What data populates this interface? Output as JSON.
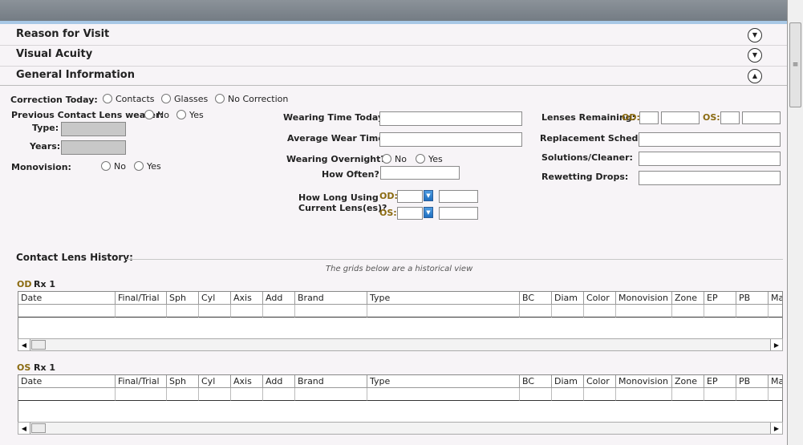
{
  "accordion": {
    "sections": [
      {
        "title": "Reason for Visit",
        "state": "collapsed"
      },
      {
        "title": "Visual Acuity",
        "state": "collapsed"
      },
      {
        "title": "General Information",
        "state": "expanded"
      }
    ]
  },
  "general": {
    "correction_today_label": "Correction Today:",
    "correction_options": [
      "Contacts",
      "Glasses",
      "No Correction"
    ],
    "previous_wearer_label": "Previous Contact Lens wearer:",
    "yes_no": [
      "No",
      "Yes"
    ],
    "type_label": "Type:",
    "years_label": "Years:",
    "monovision_label": "Monovision:",
    "wearing_time_today_label": "Wearing Time Today:",
    "average_wear_time_label": "Average Wear Time:",
    "wearing_overnight_label": "Wearing Overnight?",
    "how_often_label": "How Often?",
    "how_long_using_label_1": "How Long Using",
    "how_long_using_label_2": "Current Lens(es)?",
    "od_label": "OD:",
    "os_label": "OS:",
    "lenses_remaining_label": "Lenses Remaining:",
    "replacement_schedule_label": "Replacement Schedule:",
    "solutions_cleaner_label": "Solutions/Cleaner:",
    "rewetting_drops_label": "Rewetting Drops:"
  },
  "history": {
    "title": "Contact Lens History:",
    "note": "The grids below are a historical view",
    "od_eye": "OD",
    "os_eye": "OS",
    "rx_label": "Rx 1",
    "columns": [
      "Date",
      "Final/Trial",
      "Sph",
      "Cyl",
      "Axis",
      "Add",
      "Brand",
      "Type",
      "BC",
      "Diam",
      "Color",
      "Monovision",
      "Zone",
      "EP",
      "PB",
      "Ma"
    ]
  },
  "colors": {
    "eye_label": "#8a6a10",
    "header_bar": "#7b838b",
    "accent": "#a8c8e6"
  },
  "icons": {
    "collapsed": "chevron-down-icon",
    "expanded": "chevron-up-icon",
    "scroll_left": "arrow-left-icon",
    "scroll_right": "arrow-right-icon"
  }
}
